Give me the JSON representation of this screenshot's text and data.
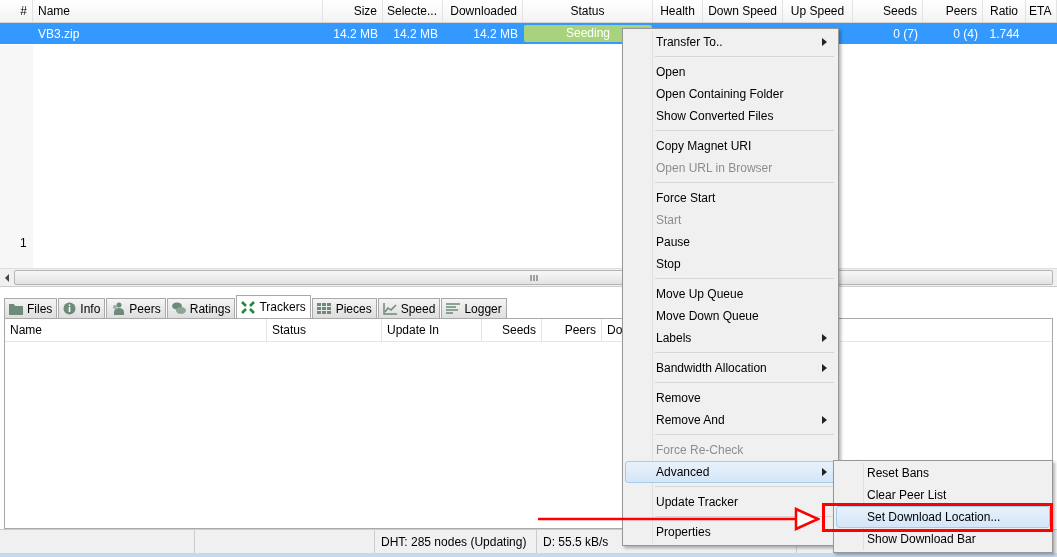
{
  "torrents": {
    "columns": [
      "#",
      "Name",
      "Size",
      "Selecte...",
      "Downloaded",
      "Status",
      "Health",
      "Down Speed",
      "Up Speed",
      "Seeds",
      "Peers",
      "Ratio",
      "ETA"
    ],
    "rows": [
      {
        "selected": true,
        "name": "VB3.zip",
        "size": "14.2 MB",
        "selected_size": "14.2 MB",
        "downloaded": "14.2 MB",
        "status": "Seeding",
        "seeds": "0 (7)",
        "peers": "0 (4)",
        "ratio": "1.744"
      }
    ],
    "row_number": "1"
  },
  "tabs": [
    {
      "label": "Files",
      "selected": false
    },
    {
      "label": "Info",
      "selected": false
    },
    {
      "label": "Peers",
      "selected": false
    },
    {
      "label": "Ratings",
      "selected": false
    },
    {
      "label": "Trackers",
      "selected": true
    },
    {
      "label": "Pieces",
      "selected": false
    },
    {
      "label": "Speed",
      "selected": false
    },
    {
      "label": "Logger",
      "selected": false
    }
  ],
  "trackers": {
    "columns": [
      "Name",
      "Status",
      "Update In",
      "Seeds",
      "Peers",
      "Do"
    ]
  },
  "status_bar": {
    "dht": "DHT: 285 nodes (Updating)",
    "download": "D: 55.5 kB/s"
  },
  "context_menu": {
    "groups": [
      [
        {
          "label": "Transfer To..",
          "disabled": false,
          "submenu": true,
          "selected": false
        }
      ],
      [
        {
          "label": "Open",
          "disabled": false,
          "submenu": false,
          "selected": false
        },
        {
          "label": "Open Containing Folder",
          "disabled": false,
          "submenu": false,
          "selected": false
        },
        {
          "label": "Show Converted Files",
          "disabled": false,
          "submenu": false,
          "selected": false
        }
      ],
      [
        {
          "label": "Copy Magnet URI",
          "disabled": false,
          "submenu": false,
          "selected": false
        },
        {
          "label": "Open URL in Browser",
          "disabled": true,
          "submenu": false,
          "selected": false
        }
      ],
      [
        {
          "label": "Force Start",
          "disabled": false,
          "submenu": false,
          "selected": false
        },
        {
          "label": "Start",
          "disabled": true,
          "submenu": false,
          "selected": false
        },
        {
          "label": "Pause",
          "disabled": false,
          "submenu": false,
          "selected": false
        },
        {
          "label": "Stop",
          "disabled": false,
          "submenu": false,
          "selected": false
        }
      ],
      [
        {
          "label": "Move Up Queue",
          "disabled": false,
          "submenu": false,
          "selected": false
        },
        {
          "label": "Move Down Queue",
          "disabled": false,
          "submenu": false,
          "selected": false
        },
        {
          "label": "Labels",
          "disabled": false,
          "submenu": true,
          "selected": false
        }
      ],
      [
        {
          "label": "Bandwidth Allocation",
          "disabled": false,
          "submenu": true,
          "selected": false
        }
      ],
      [
        {
          "label": "Remove",
          "disabled": false,
          "submenu": false,
          "selected": false
        },
        {
          "label": "Remove And",
          "disabled": false,
          "submenu": true,
          "selected": false
        }
      ],
      [
        {
          "label": "Force Re-Check",
          "disabled": true,
          "submenu": false,
          "selected": false
        },
        {
          "label": "Advanced",
          "disabled": false,
          "submenu": true,
          "selected": true
        }
      ],
      [
        {
          "label": "Update Tracker",
          "disabled": false,
          "submenu": false,
          "selected": false
        }
      ],
      [
        {
          "label": "Properties",
          "disabled": false,
          "submenu": false,
          "selected": false
        }
      ]
    ]
  },
  "submenu": {
    "items": [
      {
        "label": "Reset Bans",
        "selected": false
      },
      {
        "label": "Clear Peer List",
        "selected": false
      },
      {
        "label": "Set Download Location...",
        "selected": true
      },
      {
        "label": "Show Download Bar",
        "selected": false
      }
    ]
  }
}
